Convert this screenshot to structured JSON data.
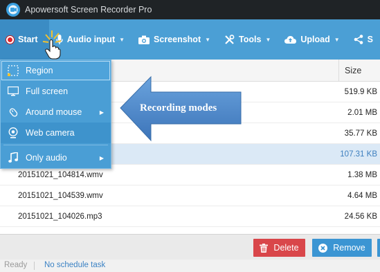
{
  "window": {
    "title": "Apowersoft Screen Recorder Pro"
  },
  "toolbar": {
    "start": "Start",
    "audio_input": "Audio input",
    "screenshot": "Screenshot",
    "tools": "Tools",
    "upload": "Upload",
    "share_partial": "S"
  },
  "table": {
    "header_size": "Size",
    "rows": [
      {
        "name": "",
        "size": "519.9 KB",
        "selected": false
      },
      {
        "name": "",
        "size": "2.01 MB",
        "selected": false
      },
      {
        "name": "",
        "size": "35.77 KB",
        "selected": false
      },
      {
        "name": "",
        "size": "107.31 KB",
        "selected": true
      },
      {
        "name": "20151021_104814.wmv",
        "size": "1.38 MB",
        "selected": false
      },
      {
        "name": "20151021_104539.wmv",
        "size": "4.64 MB",
        "selected": false
      },
      {
        "name": "20151021_104026.mp3",
        "size": "24.56 KB",
        "selected": false
      }
    ]
  },
  "menu": {
    "items": [
      {
        "label": "Region",
        "icon": "region-select-icon"
      },
      {
        "label": "Full screen",
        "icon": "monitor-icon"
      },
      {
        "label": "Around mouse",
        "icon": "mouse-icon",
        "submenu": true
      },
      {
        "label": "Web camera",
        "icon": "webcam-icon"
      },
      {
        "label": "Only audio",
        "icon": "music-note-icon",
        "submenu": true
      }
    ]
  },
  "annotation": {
    "label": "Recording modes"
  },
  "actions": {
    "delete": "Delete",
    "remove": "Remove"
  },
  "status": {
    "ready": "Ready",
    "schedule": "No schedule task"
  },
  "colors": {
    "toolbar": "#4b9fd5",
    "titlebar": "#1f2326",
    "delete": "#d9464a",
    "remove": "#3b95d3",
    "selected_row": "#dbe9f6",
    "arrow": "#4a86c8"
  }
}
